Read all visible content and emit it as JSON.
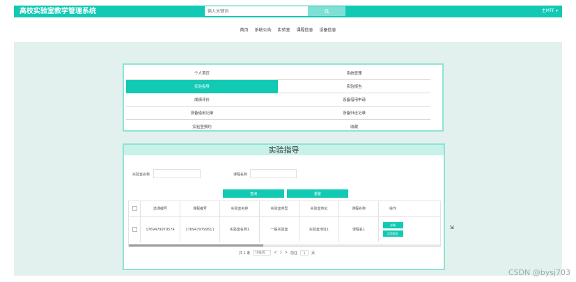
{
  "header": {
    "app_title": "高校实验室教学管理系统",
    "search_placeholder": "输入关键词",
    "user_label": "主MTF"
  },
  "nav": {
    "items": [
      "首页",
      "系统公告",
      "实验室",
      "课程信息",
      "设备信息"
    ]
  },
  "menu": {
    "items": [
      {
        "label": "个人首页",
        "active": false
      },
      {
        "label": "系统管理",
        "active": false
      },
      {
        "label": "实验指导",
        "active": true
      },
      {
        "label": "实验报告",
        "active": false
      },
      {
        "label": "成绩评价",
        "active": false
      },
      {
        "label": "设备借用申请",
        "active": false
      },
      {
        "label": "设备借用记录",
        "active": false
      },
      {
        "label": "设备归还记录",
        "active": false
      },
      {
        "label": "实验室预约",
        "active": false
      },
      {
        "label": "收藏",
        "active": false
      }
    ]
  },
  "panel": {
    "title": "实验指导",
    "filters": {
      "lab_name_label": "实验室名称",
      "course_name_label": "课程名称"
    },
    "buttons": {
      "query": "查询",
      "reset": "重置"
    },
    "table": {
      "columns": [
        "选课编号",
        "课程编号",
        "实验室名称",
        "实验室类型",
        "实验室地址",
        "课程名称",
        "操作"
      ],
      "rows": [
        {
          "cells": [
            "1769479979574",
            "1769479799511",
            "实验室名称1",
            "一般实验室",
            "实验室地址1",
            "课程名1"
          ],
          "actions": [
            "详情",
            "实验报告"
          ]
        }
      ]
    },
    "pagination": {
      "total_text": "共 1 条",
      "page_size": "10条/页",
      "prev": "<",
      "page": "1",
      "next": ">",
      "goto_label": "前往",
      "goto_value": "1",
      "page_unit": "页"
    }
  },
  "watermark": "CSDN @bysj703",
  "colors": {
    "accent": "#12c9b4",
    "panel_header_bg": "#c8f1ea",
    "main_bg": "#e3f1ee"
  }
}
